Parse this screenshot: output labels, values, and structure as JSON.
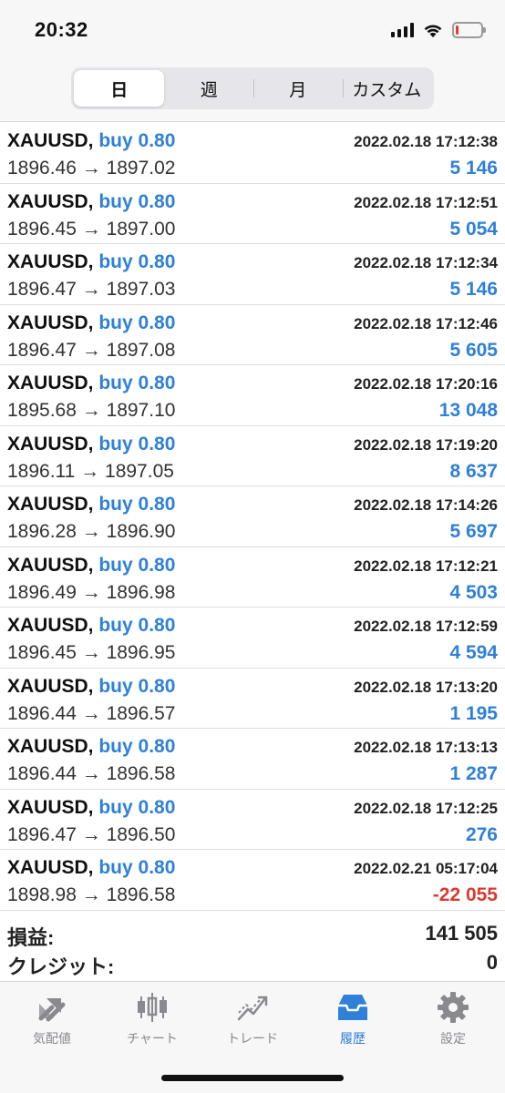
{
  "status": {
    "time": "20:32",
    "battery_color": "#e53935",
    "battery_level": 0.12
  },
  "period_tabs": [
    {
      "label": "日",
      "active": true
    },
    {
      "label": "週",
      "active": false
    },
    {
      "label": "月",
      "active": false
    },
    {
      "label": "カスタム",
      "active": false
    }
  ],
  "deals": [
    {
      "symbol": "XAUUSD,",
      "side": "buy 0.80",
      "time": "2022.02.18 17:12:38",
      "prices": "1896.46 → 1897.02",
      "profit": "5 146",
      "negative": false
    },
    {
      "symbol": "XAUUSD,",
      "side": "buy 0.80",
      "time": "2022.02.18 17:12:51",
      "prices": "1896.45 → 1897.00",
      "profit": "5 054",
      "negative": false
    },
    {
      "symbol": "XAUUSD,",
      "side": "buy 0.80",
      "time": "2022.02.18 17:12:34",
      "prices": "1896.47 → 1897.03",
      "profit": "5 146",
      "negative": false
    },
    {
      "symbol": "XAUUSD,",
      "side": "buy 0.80",
      "time": "2022.02.18 17:12:46",
      "prices": "1896.47 → 1897.08",
      "profit": "5 605",
      "negative": false
    },
    {
      "symbol": "XAUUSD,",
      "side": "buy 0.80",
      "time": "2022.02.18 17:20:16",
      "prices": "1895.68 → 1897.10",
      "profit": "13 048",
      "negative": false
    },
    {
      "symbol": "XAUUSD,",
      "side": "buy 0.80",
      "time": "2022.02.18 17:19:20",
      "prices": "1896.11 → 1897.05",
      "profit": "8 637",
      "negative": false
    },
    {
      "symbol": "XAUUSD,",
      "side": "buy 0.80",
      "time": "2022.02.18 17:14:26",
      "prices": "1896.28 → 1896.90",
      "profit": "5 697",
      "negative": false
    },
    {
      "symbol": "XAUUSD,",
      "side": "buy 0.80",
      "time": "2022.02.18 17:12:21",
      "prices": "1896.49 → 1896.98",
      "profit": "4 503",
      "negative": false
    },
    {
      "symbol": "XAUUSD,",
      "side": "buy 0.80",
      "time": "2022.02.18 17:12:59",
      "prices": "1896.45 → 1896.95",
      "profit": "4 594",
      "negative": false
    },
    {
      "symbol": "XAUUSD,",
      "side": "buy 0.80",
      "time": "2022.02.18 17:13:20",
      "prices": "1896.44 → 1896.57",
      "profit": "1 195",
      "negative": false
    },
    {
      "symbol": "XAUUSD,",
      "side": "buy 0.80",
      "time": "2022.02.18 17:13:13",
      "prices": "1896.44 → 1896.58",
      "profit": "1 287",
      "negative": false
    },
    {
      "symbol": "XAUUSD,",
      "side": "buy 0.80",
      "time": "2022.02.18 17:12:25",
      "prices": "1896.47 → 1896.50",
      "profit": "276",
      "negative": false
    },
    {
      "symbol": "XAUUSD,",
      "side": "buy 0.80",
      "time": "2022.02.21 05:17:04",
      "prices": "1898.98 → 1896.58",
      "profit": "-22 055",
      "negative": true
    }
  ],
  "summary": {
    "profit_label": "損益:",
    "profit_value": "141 505",
    "credit_label": "クレジット:",
    "credit_value": "0"
  },
  "tabbar": [
    {
      "label": "気配値",
      "icon": "quotes-arrows-icon",
      "active": false
    },
    {
      "label": "チャート",
      "icon": "candlestick-chart-icon",
      "active": false
    },
    {
      "label": "トレード",
      "icon": "trade-line-icon",
      "active": false
    },
    {
      "label": "履歴",
      "icon": "history-inbox-icon",
      "active": true
    },
    {
      "label": "設定",
      "icon": "gear-icon",
      "active": false
    }
  ],
  "colors": {
    "accent": "#2f80d7",
    "negative": "#d93b2f",
    "inactive": "#8a8a8e"
  }
}
